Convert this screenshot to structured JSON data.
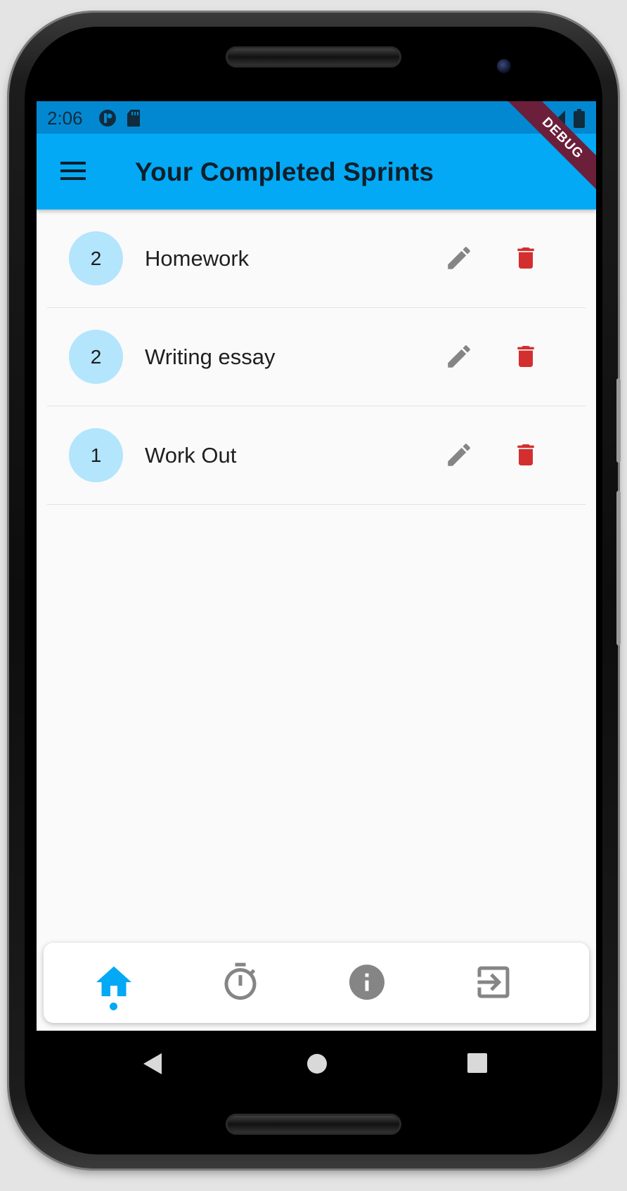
{
  "status_bar": {
    "time": "2:06"
  },
  "debug_banner": "DEBUG",
  "app_bar": {
    "title": "Your Completed Sprints",
    "menu_icon": "menu-icon"
  },
  "sprints": [
    {
      "count": "2",
      "title": "Homework"
    },
    {
      "count": "2",
      "title": "Writing essay"
    },
    {
      "count": "1",
      "title": "Work Out"
    }
  ],
  "bottom_nav": {
    "items": [
      {
        "icon": "home-icon",
        "active": true
      },
      {
        "icon": "timer-icon",
        "active": false
      },
      {
        "icon": "info-icon",
        "active": false
      },
      {
        "icon": "logout-icon",
        "active": false
      }
    ]
  },
  "colors": {
    "status_bar": "#0288d1",
    "app_bar": "#03a9f4",
    "avatar_bg": "#b3e5fc",
    "edit_icon": "#858585",
    "delete_icon": "#d32f2f",
    "nav_active": "#03a9f4",
    "nav_inactive": "#858585",
    "debug_ribbon": "#6b1f3a"
  }
}
